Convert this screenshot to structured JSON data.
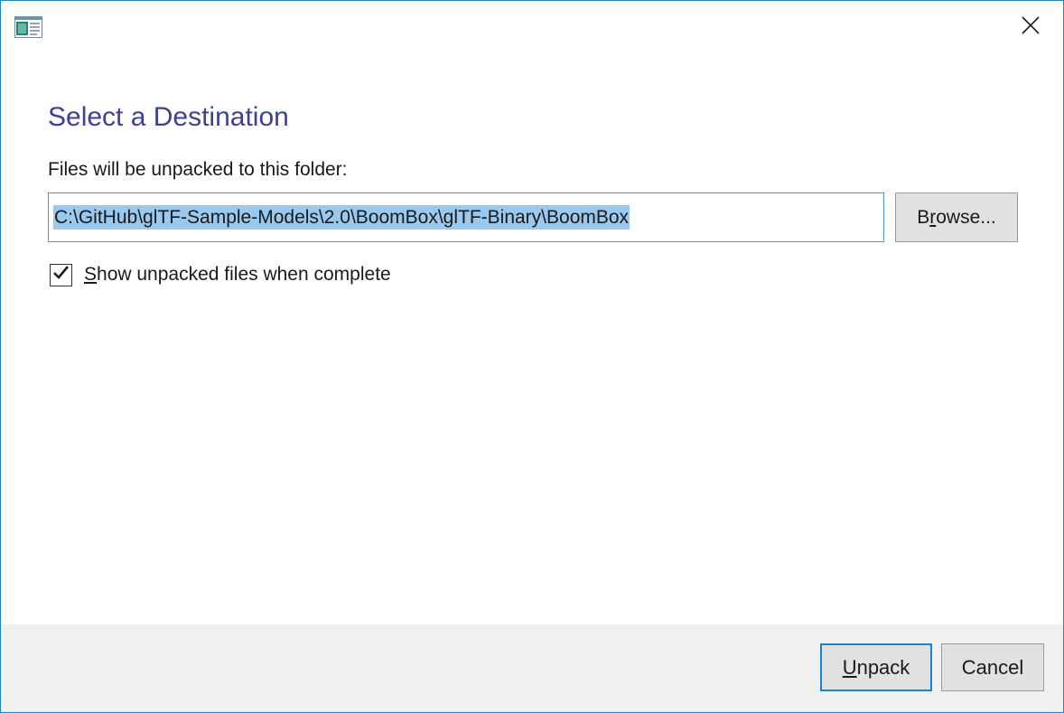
{
  "titlebar": {
    "icon": "installer-app-icon",
    "close_icon": "close-icon"
  },
  "main": {
    "heading": "Select a Destination",
    "folder_label": "Files will be unpacked to this folder:",
    "path_value": "C:\\GitHub\\glTF-Sample-Models\\2.0\\BoomBox\\glTF-Binary\\BoomBox",
    "browse": {
      "mnemonic": "r",
      "pre": "B",
      "post": "owse..."
    },
    "checkbox": {
      "checked": true,
      "mnemonic": "S",
      "post": "how unpacked files when complete"
    }
  },
  "footer": {
    "unpack": {
      "mnemonic": "U",
      "post": "npack"
    },
    "cancel_label": "Cancel"
  },
  "colors": {
    "accent": "#1883d7",
    "heading": "#3b3f9e",
    "selection": "#99c9ef",
    "button_face": "#e1e1e1",
    "footer_bg": "#f0f0f0"
  }
}
